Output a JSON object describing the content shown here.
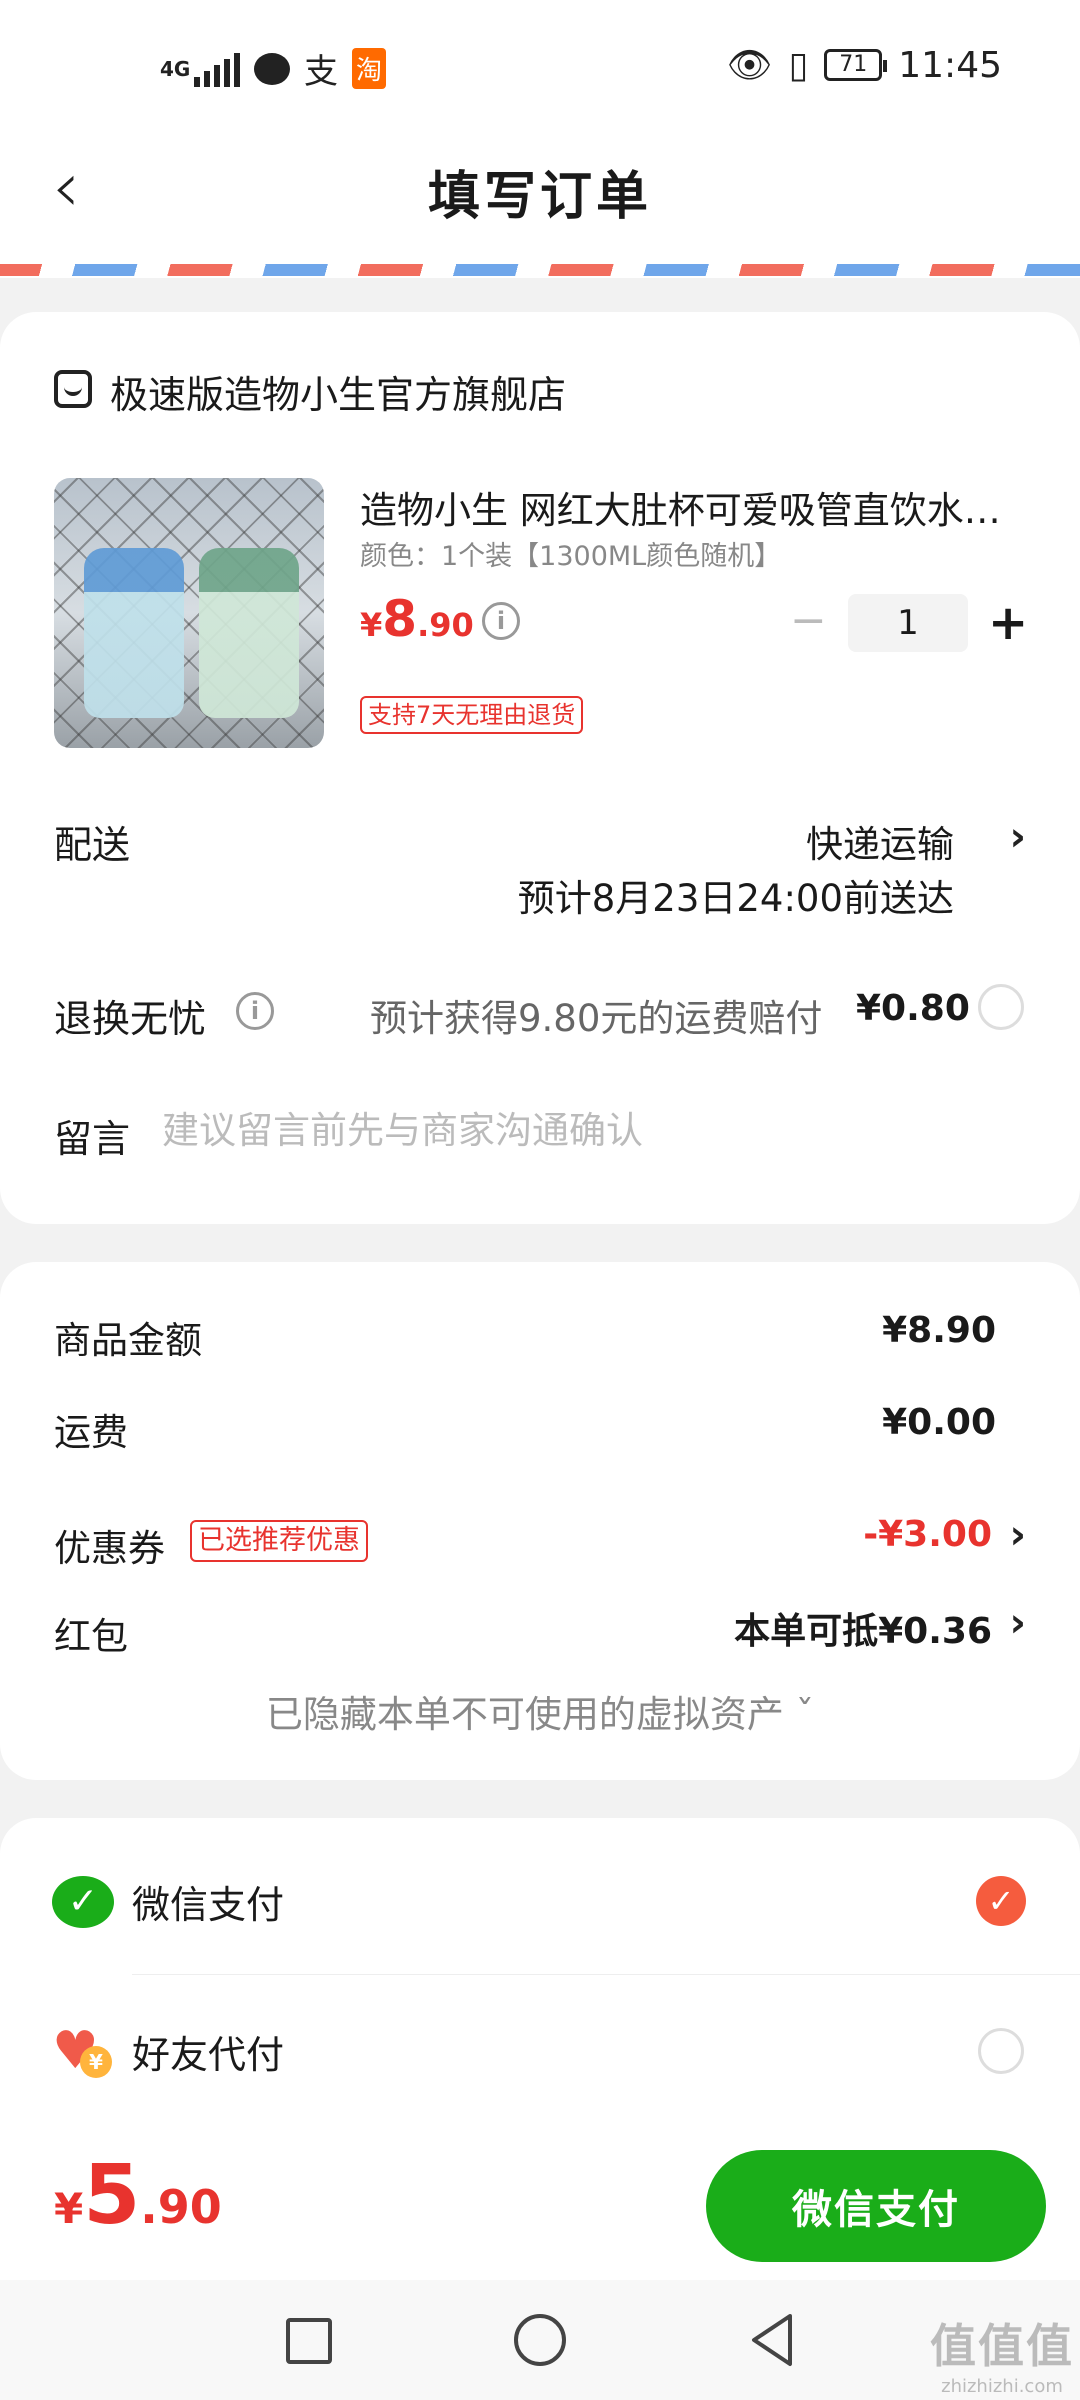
{
  "status_bar": {
    "network": "4G",
    "time": "11:45",
    "battery": "71",
    "icons": [
      "signal-icon",
      "chat-bubble-icon",
      "alipay-icon",
      "taobao-icon",
      "eye-icon",
      "vibrate-icon",
      "battery-icon"
    ],
    "app_zhi": "支",
    "app_tao": "淘"
  },
  "header": {
    "title": "填写订单",
    "back_icon": "chevron-left-icon"
  },
  "store": {
    "name": "极速版造物小生官方旗舰店"
  },
  "product": {
    "title": "造物小生  网红大肚杯可爱吸管直饮水杯女生高颜值",
    "spec": "颜色：1个装【1300ML颜色随机】",
    "price_symbol": "¥",
    "price_int": "8",
    "price_dec": ".90",
    "quantity": "1",
    "minus": "−",
    "plus": "+",
    "return_tag": "支持7天无理由退货"
  },
  "delivery": {
    "label": "配送",
    "method": "快递运输",
    "eta": "预计8月23日24:00前送达"
  },
  "exchange": {
    "label": "退换无忧",
    "description": "预计获得9.80元的运费赔付",
    "fee": "¥0.80"
  },
  "message": {
    "label": "留言",
    "placeholder": "建议留言前先与商家沟通确认"
  },
  "summary": {
    "goods_label": "商品金额",
    "goods_value": "¥8.90",
    "shipping_label": "运费",
    "shipping_value": "¥0.00",
    "coupon_label": "优惠券",
    "coupon_tag": "已选推荐优惠",
    "coupon_value": "-¥3.00",
    "redpacket_label": "红包",
    "redpacket_value": "本单可抵¥0.36",
    "hidden_assets": "已隐藏本单不可使用的虚拟资产 ˇ"
  },
  "payment": {
    "methods": [
      {
        "label": "微信支付",
        "icon": "wechat-pay-icon",
        "selected": true
      },
      {
        "label": "好友代付",
        "icon": "friend-pay-heart-icon",
        "selected": false
      }
    ]
  },
  "footer": {
    "total_symbol": "¥",
    "total_int": "5",
    "total_dec": ".90",
    "pay_button": "微信支付"
  },
  "watermark": {
    "text": "值值值",
    "url": "zhizhizhi.com"
  },
  "colors": {
    "accent_red": "#e8332e",
    "wechat_green": "#1aad19",
    "check_orange": "#f55c3e"
  }
}
